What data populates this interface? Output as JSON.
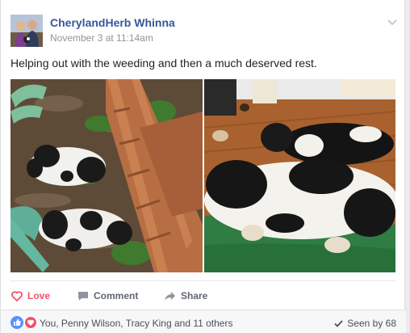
{
  "post": {
    "author": "CherylandHerb Whinna",
    "timestamp": "November 3 at 11:14am",
    "text": "Helping out with the weeding and then a much deserved rest.",
    "photos": [
      {
        "alt": "Two black and white puppies among wood chips by a wooden play structure"
      },
      {
        "alt": "Two black and white dogs resting on a green blanket on a wood floor"
      }
    ]
  },
  "actions": {
    "love_label": "Love",
    "comment_label": "Comment",
    "share_label": "Share"
  },
  "reactions": {
    "icons": [
      "like-icon",
      "love-icon"
    ],
    "summary": "You, Penny Wilson, Tracy King and 11 others",
    "seen": "Seen by 68"
  },
  "colors": {
    "link": "#365899",
    "love": "#f25268",
    "like": "#5890ff",
    "muted": "#90949c"
  }
}
